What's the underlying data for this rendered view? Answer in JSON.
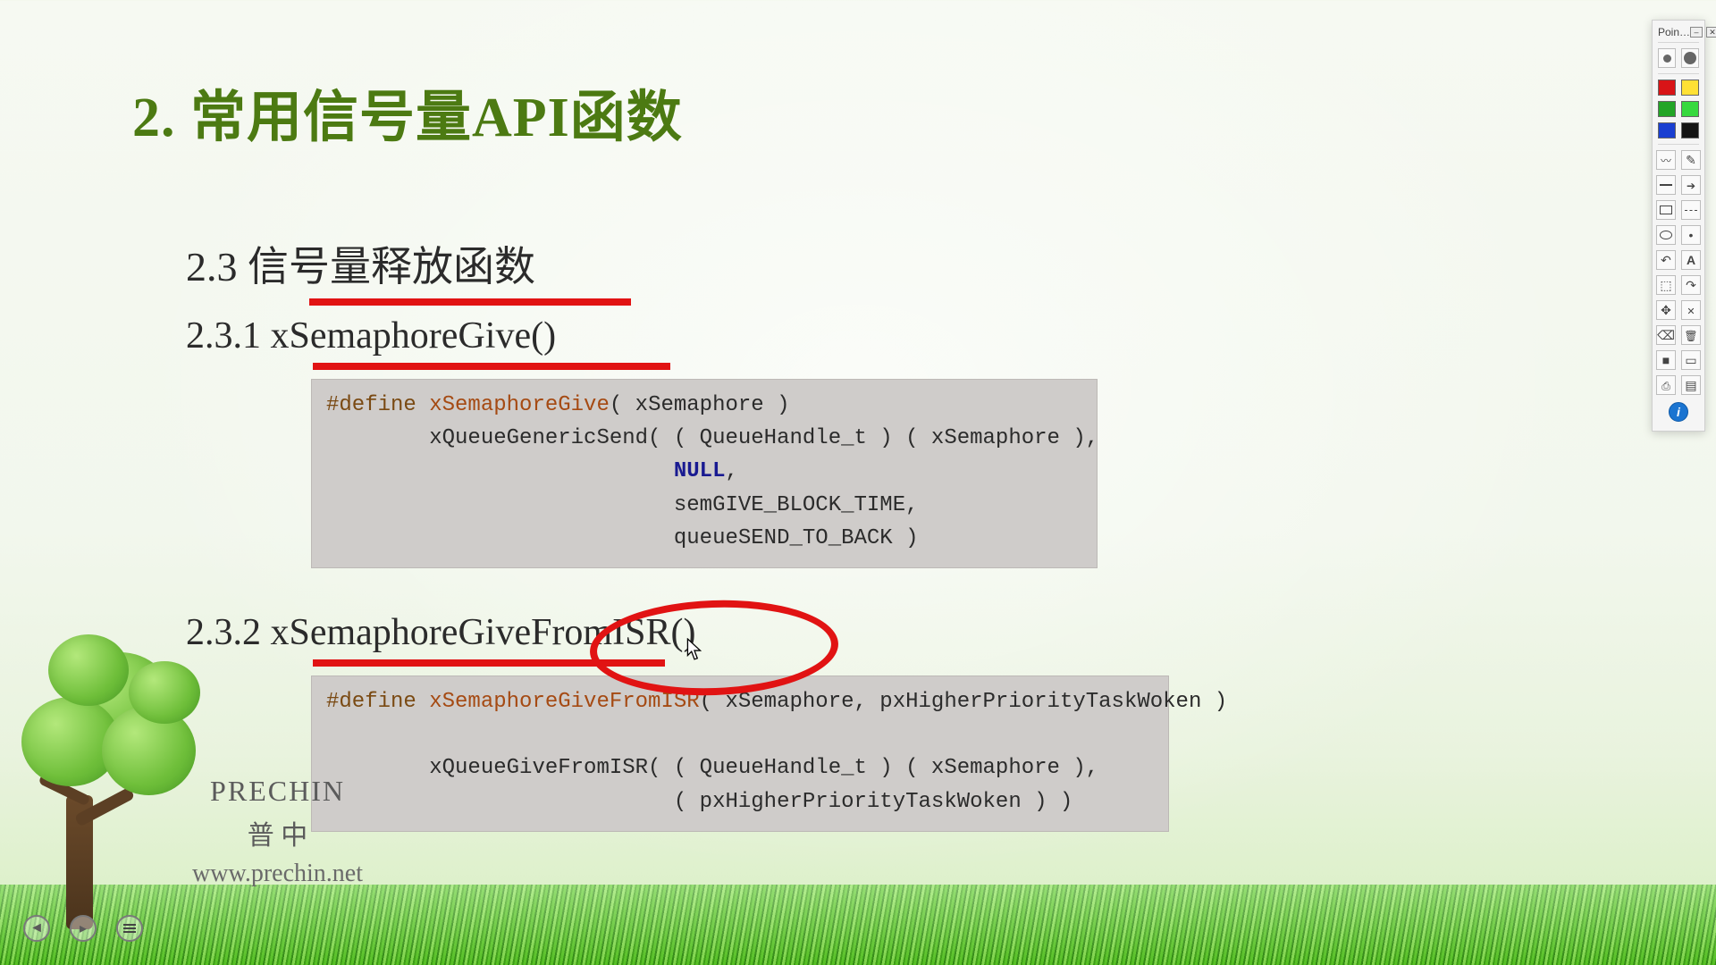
{
  "slide": {
    "title": "2. 常用信号量API函数",
    "section": {
      "num": "2.3",
      "text": "信号量释放函数"
    },
    "sub1": {
      "num": "2.3.1",
      "text": "xSemaphoreGive()"
    },
    "sub2": {
      "num": "2.3.2",
      "text": "xSemaphoreGiveFromISR()"
    },
    "code1": {
      "l1a": "#define ",
      "l1b": "xSemaphoreGive",
      "l1c": "( xSemaphore )",
      "l2": "        xQueueGenericSend( ( QueueHandle_t ) ( xSemaphore ),",
      "l3a": "                           ",
      "l3b": "NULL",
      "l3c": ",",
      "l4": "                           semGIVE_BLOCK_TIME,",
      "l5": "                           queueSEND_TO_BACK )"
    },
    "code2": {
      "l1a": "#define ",
      "l1b": "xSemaphoreGiveFromISR",
      "l1c": "( xSemaphore, pxHigherPriorityTaskWoken )",
      "blank": " ",
      "l2": "        xQueueGiveFromISR( ( QueueHandle_t ) ( xSemaphore ),",
      "l3": "                           ( pxHigherPriorityTaskWoken ) )"
    }
  },
  "brand": {
    "en": "PRECHIN",
    "zh": "普 中",
    "url": "www.prechin.net"
  },
  "palette": {
    "title": "Poin…",
    "close": "✕",
    "colors": [
      "#d81417",
      "#ffe135",
      "#23a527",
      "#36d93e",
      "#1a3fd1",
      "#151515"
    ],
    "size_small": "small",
    "size_large": "large"
  },
  "annotations": {
    "underline_section_w": "360",
    "underline_sub1_w": "400",
    "underline_sub2_w": "394"
  },
  "accent": {
    "red": "#e11313"
  }
}
